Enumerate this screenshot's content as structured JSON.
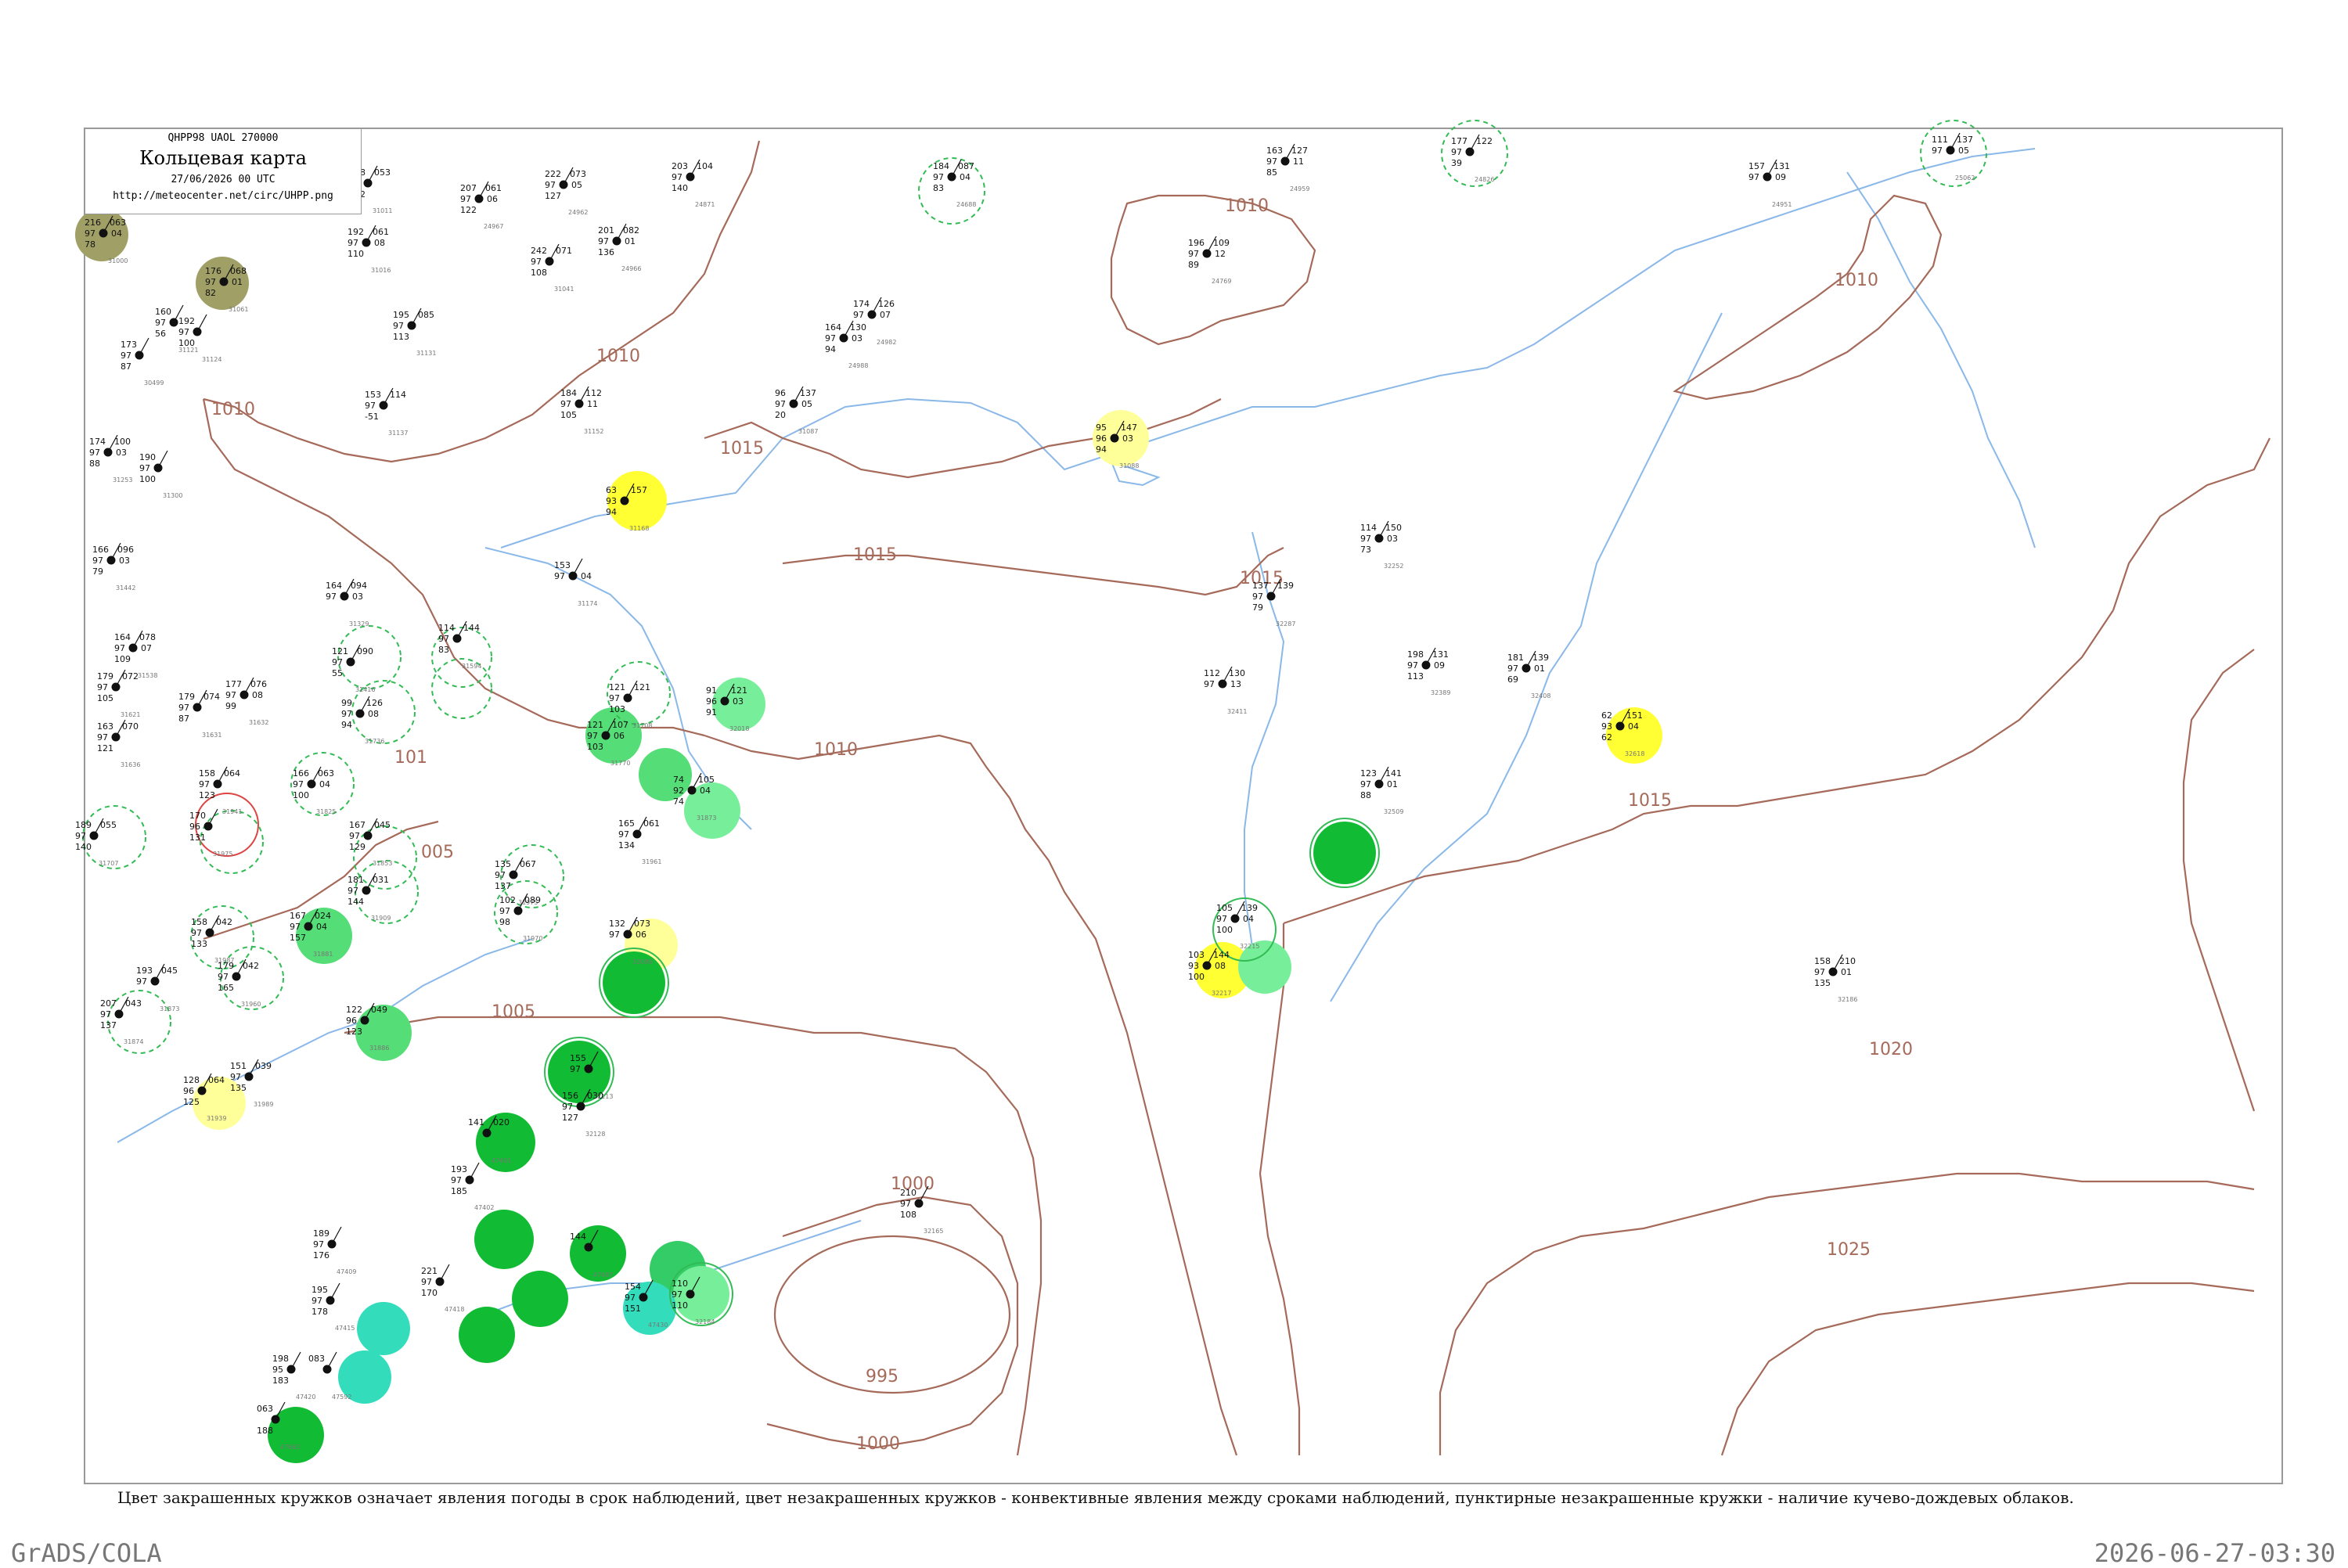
{
  "header": {
    "code": "QHPP98  UAOL  270000",
    "title": "Кольцевая карта",
    "date": "27/06/2026 00 UTC",
    "url": "http://meteocenter.net/circ/UHPP.png"
  },
  "caption": "Цвет закрашенных кружков означает явления погоды в срок наблюдений, цвет незакрашенных кружков - конвективные явления между сроками наблюдений, пунктирные незакрашенные кружки - наличие кучево-дождевых облаков.",
  "footer": {
    "left": "GrADS/COLA",
    "right": "2026-06-27-03:30"
  },
  "colors": {
    "isobar": "#a56a5a",
    "coast": "#8ab8e8",
    "frame": "#888888",
    "olive": "#9f9f66",
    "yellow": "#ffff33",
    "pale_yellow": "#ffff99",
    "green_dark": "#11bb33",
    "green_mid": "#55dd77",
    "green_light": "#77ee99",
    "teal": "#33ddbb",
    "dashed_green": "#33bb55"
  },
  "isobar_labels": [
    {
      "key": "l1010a",
      "text": "1010"
    },
    {
      "key": "l1010b",
      "text": "1010"
    },
    {
      "key": "l1010c",
      "text": "1010"
    },
    {
      "key": "l1010d",
      "text": "1010"
    },
    {
      "key": "l1010e",
      "text": "1010"
    },
    {
      "key": "l1010f",
      "text": "101"
    },
    {
      "key": "l1015a",
      "text": "1015"
    },
    {
      "key": "l1015b",
      "text": "1015"
    },
    {
      "key": "l1015c",
      "text": "1015"
    },
    {
      "key": "l1015d",
      "text": "1015"
    },
    {
      "key": "l1005a",
      "text": "005"
    },
    {
      "key": "l1005b",
      "text": "1005"
    },
    {
      "key": "l1000a",
      "text": "1000"
    },
    {
      "key": "l1000b",
      "text": "1000"
    },
    {
      "key": "l995",
      "text": "995"
    },
    {
      "key": "l1020",
      "text": "1020"
    },
    {
      "key": "l1025",
      "text": "1025"
    }
  ],
  "stations": [
    {
      "tl": "216",
      "tr": "063",
      "ml": "97",
      "mr": "04",
      "bl": "78",
      "id": "31000"
    },
    {
      "tl": "176",
      "tr": "068",
      "ml": "97",
      "mr": "01",
      "bl": "82",
      "id": "31061"
    },
    {
      "tl": "160",
      "tr": "",
      "ml": "97",
      "mr": "",
      "bl": "56",
      "id": "31121"
    },
    {
      "tl": "192",
      "tr": "",
      "ml": "97",
      "mr": "",
      "bl": "100",
      "id": "31124"
    },
    {
      "tl": "173",
      "tr": "",
      "ml": "97",
      "mr": "",
      "bl": "87",
      "id": "30499"
    },
    {
      "tl": "198",
      "tr": "053",
      "ml": "97",
      "mr": "",
      "bl": "162",
      "id": "31011"
    },
    {
      "tl": "192",
      "tr": "061",
      "ml": "97",
      "mr": "08",
      "bl": "110",
      "id": "31016"
    },
    {
      "tl": "207",
      "tr": "061",
      "ml": "97",
      "mr": "06",
      "bl": "122",
      "id": "24967"
    },
    {
      "tl": "222",
      "tr": "073",
      "ml": "97",
      "mr": "05",
      "bl": "127",
      "id": "24962"
    },
    {
      "tl": "201",
      "tr": "082",
      "ml": "97",
      "mr": "01",
      "bl": "136",
      "id": "24966"
    },
    {
      "tl": "242",
      "tr": "071",
      "ml": "97",
      "mr": "",
      "bl": "108",
      "id": "31041"
    },
    {
      "tl": "203",
      "tr": "104",
      "ml": "97",
      "mr": "",
      "bl": "140",
      "id": "24871"
    },
    {
      "tl": "184",
      "tr": "087",
      "ml": "97",
      "mr": "04",
      "bl": "83",
      "id": "24688"
    },
    {
      "tl": "163",
      "tr": "127",
      "ml": "97",
      "mr": "11",
      "bl": "85",
      "id": "24959"
    },
    {
      "tl": "196",
      "tr": "109",
      "ml": "97",
      "mr": "12",
      "bl": "89",
      "id": "24769"
    },
    {
      "tl": "177",
      "tr": "122",
      "ml": "97",
      "mr": "",
      "bl": "39",
      "id": "24826"
    },
    {
      "tl": "157",
      "tr": "131",
      "ml": "97",
      "mr": "09",
      "bl": "",
      "id": "24951"
    },
    {
      "tl": "111",
      "tr": "137",
      "ml": "97",
      "mr": "05",
      "bl": "",
      "id": "25062"
    },
    {
      "tl": "195",
      "tr": "085",
      "ml": "97",
      "mr": "",
      "bl": "113",
      "id": "31131"
    },
    {
      "tl": "174",
      "tr": "126",
      "ml": "97",
      "mr": "07",
      "bl": "",
      "id": "24982"
    },
    {
      "tl": "164",
      "tr": "130",
      "ml": "97",
      "mr": "03",
      "bl": "94",
      "id": "24988"
    },
    {
      "tl": "96",
      "tr": "137",
      "ml": "97",
      "mr": "05",
      "bl": "20",
      "id": "31087"
    },
    {
      "tl": "184",
      "tr": "112",
      "ml": "97",
      "mr": "11",
      "bl": "105",
      "id": "31152"
    },
    {
      "tl": "153",
      "tr": "114",
      "ml": "97",
      "mr": "",
      "bl": "-51",
      "id": "31137"
    },
    {
      "tl": "95",
      "tr": "147",
      "ml": "96",
      "mr": "03",
      "bl": "94",
      "id": "31088"
    },
    {
      "tl": "63",
      "tr": "157",
      "ml": "93",
      "mr": "",
      "bl": "94",
      "id": "31168"
    },
    {
      "tl": "174",
      "tr": "100",
      "ml": "97",
      "mr": "03",
      "bl": "88",
      "id": "31253"
    },
    {
      "tl": "190",
      "tr": "",
      "ml": "97",
      "mr": "",
      "bl": "100",
      "id": "31300"
    },
    {
      "tl": "166",
      "tr": "096",
      "ml": "97",
      "mr": "03",
      "bl": "79",
      "id": "31442"
    },
    {
      "tl": "153",
      "tr": "",
      "ml": "97",
      "mr": "04",
      "bl": "",
      "id": "31174"
    },
    {
      "tl": "164",
      "tr": "094",
      "ml": "97",
      "mr": "03",
      "bl": "",
      "id": "31329"
    },
    {
      "tl": "164",
      "tr": "078",
      "ml": "97",
      "mr": "07",
      "bl": "109",
      "id": "31538"
    },
    {
      "tl": "121",
      "tr": "090",
      "ml": "97",
      "mr": "",
      "bl": "55",
      "id": "31416"
    },
    {
      "tl": "114",
      "tr": "144",
      "ml": "97",
      "mr": "",
      "bl": "83",
      "id": "31594"
    },
    {
      "tl": "179",
      "tr": "072",
      "ml": "97",
      "mr": "",
      "bl": "105",
      "id": "31621"
    },
    {
      "tl": "177",
      "tr": "076",
      "ml": "97",
      "mr": "08",
      "bl": "99",
      "id": "31632"
    },
    {
      "tl": "179",
      "tr": "074",
      "ml": "97",
      "mr": "",
      "bl": "87",
      "id": "31631"
    },
    {
      "tl": "163",
      "tr": "070",
      "ml": "97",
      "mr": "",
      "bl": "121",
      "id": "31636"
    },
    {
      "tl": "99",
      "tr": "126",
      "ml": "97",
      "mr": "08",
      "bl": "94",
      "id": "31736"
    },
    {
      "tl": "121",
      "tr": "121",
      "ml": "97",
      "mr": "",
      "bl": "103",
      "id": "31708"
    },
    {
      "tl": "121",
      "tr": "107",
      "ml": "97",
      "mr": "06",
      "bl": "103",
      "id": "31770"
    },
    {
      "tl": "91",
      "tr": "121",
      "ml": "96",
      "mr": "03",
      "bl": "91",
      "id": "32018"
    },
    {
      "tl": "74",
      "tr": "105",
      "ml": "92",
      "mr": "04",
      "bl": "74",
      "id": "31873"
    },
    {
      "tl": "137",
      "tr": "139",
      "ml": "97",
      "mr": "",
      "bl": "79",
      "id": "32287"
    },
    {
      "tl": "114",
      "tr": "150",
      "ml": "97",
      "mr": "03",
      "bl": "73",
      "id": "32252"
    },
    {
      "tl": "112",
      "tr": "130",
      "ml": "97",
      "mr": "13",
      "bl": "",
      "id": "32411"
    },
    {
      "tl": "198",
      "tr": "131",
      "ml": "97",
      "mr": "09",
      "bl": "113",
      "id": "32389"
    },
    {
      "tl": "181",
      "tr": "139",
      "ml": "97",
      "mr": "01",
      "bl": "69",
      "id": "32408"
    },
    {
      "tl": "62",
      "tr": "151",
      "ml": "93",
      "mr": "04",
      "bl": "62",
      "id": "32618"
    },
    {
      "tl": "123",
      "tr": "141",
      "ml": "97",
      "mr": "01",
      "bl": "88",
      "id": "32509"
    },
    {
      "tl": "158",
      "tr": "064",
      "ml": "97",
      "mr": "",
      "bl": "123",
      "id": "31941"
    },
    {
      "tl": "170",
      "tr": "",
      "ml": "96",
      "mr": "",
      "bl": "131",
      "id": "31975"
    },
    {
      "tl": "166",
      "tr": "063",
      "ml": "97",
      "mr": "04",
      "bl": "100",
      "id": "31825"
    },
    {
      "tl": "167",
      "tr": "045",
      "ml": "97",
      "mr": "",
      "bl": "129",
      "id": "31853"
    },
    {
      "tl": "189",
      "tr": "055",
      "ml": "97",
      "mr": "",
      "bl": "140",
      "id": "31707"
    },
    {
      "tl": "181",
      "tr": "031",
      "ml": "97",
      "mr": "",
      "bl": "144",
      "id": "31909"
    },
    {
      "tl": "135",
      "tr": "067",
      "ml": "97",
      "mr": "",
      "bl": "137",
      "id": "31975"
    },
    {
      "tl": "102",
      "tr": "089",
      "ml": "97",
      "mr": "",
      "bl": "98",
      "id": "31970"
    },
    {
      "tl": "165",
      "tr": "061",
      "ml": "97",
      "mr": "",
      "bl": "134",
      "id": "31961"
    },
    {
      "tl": "167",
      "tr": "024",
      "ml": "97",
      "mr": "04",
      "bl": "157",
      "id": "31881"
    },
    {
      "tl": "158",
      "tr": "042",
      "ml": "97",
      "mr": "",
      "bl": "133",
      "id": "31987"
    },
    {
      "tl": "179",
      "tr": "042",
      "ml": "97",
      "mr": "",
      "bl": "165",
      "id": "31960"
    },
    {
      "tl": "193",
      "tr": "045",
      "ml": "97",
      "mr": "",
      "bl": "",
      "id": "31873"
    },
    {
      "tl": "207",
      "tr": "043",
      "ml": "97",
      "mr": "",
      "bl": "137",
      "id": "31874"
    },
    {
      "tl": "128",
      "tr": "064",
      "ml": "96",
      "mr": "",
      "bl": "125",
      "id": "31939"
    },
    {
      "tl": "151",
      "tr": "039",
      "ml": "97",
      "mr": "",
      "bl": "135",
      "id": "31989"
    },
    {
      "tl": "122",
      "tr": "049",
      "ml": "96",
      "mr": "",
      "bl": "123",
      "id": "31886"
    },
    {
      "tl": "132",
      "tr": "073",
      "ml": "97",
      "mr": "06",
      "bl": "",
      "id": "32098"
    },
    {
      "tl": "155",
      "tr": "",
      "ml": "97",
      "mr": "",
      "bl": "",
      "id": "32113"
    },
    {
      "tl": "156",
      "tr": "030",
      "ml": "97",
      "mr": "",
      "bl": "127",
      "id": "32128"
    },
    {
      "tl": "105",
      "tr": "139",
      "ml": "97",
      "mr": "04",
      "bl": "100",
      "id": "32215"
    },
    {
      "tl": "103",
      "tr": "144",
      "ml": "93",
      "mr": "08",
      "bl": "100",
      "id": "32217"
    },
    {
      "tl": "158",
      "tr": "210",
      "ml": "97",
      "mr": "01",
      "bl": "135",
      "id": "32186"
    },
    {
      "tl": "210",
      "tr": "",
      "ml": "97",
      "mr": "",
      "bl": "108",
      "id": "32165"
    },
    {
      "tl": "141",
      "tr": "020",
      "ml": "",
      "mr": "",
      "bl": "",
      "id": "47401"
    },
    {
      "tl": "193",
      "tr": "",
      "ml": "97",
      "mr": "",
      "bl": "185",
      "id": "47402"
    },
    {
      "tl": "144",
      "tr": "",
      "ml": "",
      "mr": "",
      "bl": "",
      "id": "47407"
    },
    {
      "tl": "154",
      "tr": "",
      "ml": "97",
      "mr": "",
      "bl": "151",
      "id": "47430"
    },
    {
      "tl": "110",
      "tr": "",
      "ml": "97",
      "mr": "",
      "bl": "110",
      "id": "32184"
    },
    {
      "tl": "189",
      "tr": "",
      "ml": "97",
      "mr": "",
      "bl": "176",
      "id": "47409"
    },
    {
      "tl": "195",
      "tr": "",
      "ml": "97",
      "mr": "",
      "bl": "178",
      "id": "47415"
    },
    {
      "tl": "221",
      "tr": "",
      "ml": "97",
      "mr": "",
      "bl": "170",
      "id": "47418"
    },
    {
      "tl": "198",
      "tr": "",
      "ml": "95",
      "mr": "",
      "bl": "183",
      "id": "47420"
    },
    {
      "tl": "083",
      "tr": "",
      "ml": "",
      "mr": "",
      "bl": "",
      "id": "47592"
    },
    {
      "tl": "063",
      "tr": "",
      "ml": "",
      "mr": "",
      "bl": "188",
      "id": "47662"
    }
  ]
}
